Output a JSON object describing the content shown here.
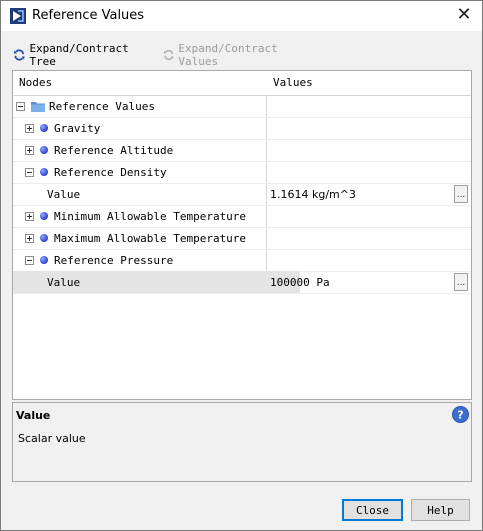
{
  "window": {
    "title": "Reference Values",
    "close_glyph": "✕"
  },
  "toolbar": {
    "expand_tree": "Expand/Contract Tree",
    "expand_values": "Expand/Contract Values"
  },
  "table": {
    "col_nodes": "Nodes",
    "col_values": "Values",
    "rows": [
      {
        "label": "Reference Values",
        "value": ""
      },
      {
        "label": "Gravity",
        "value": ""
      },
      {
        "label": "Reference Altitude",
        "value": ""
      },
      {
        "label": "Reference Density",
        "value": ""
      },
      {
        "label": "Value",
        "value": "1.1614 kg/m^3",
        "button": "..."
      },
      {
        "label": "Minimum Allowable Temperature",
        "value": ""
      },
      {
        "label": "Maximum Allowable Temperature",
        "value": ""
      },
      {
        "label": "Reference Pressure",
        "value": ""
      },
      {
        "label": "Value",
        "value": "100000 Pa",
        "button": "..."
      }
    ]
  },
  "info": {
    "title": "Value",
    "text": "Scalar value"
  },
  "buttons": {
    "close": "Close",
    "help": "Help"
  },
  "colors": {
    "accent": "#0078d7",
    "help_icon": "#3a6fd0",
    "folder": "#5a8fd8",
    "bullet": "#2a3fc4"
  }
}
